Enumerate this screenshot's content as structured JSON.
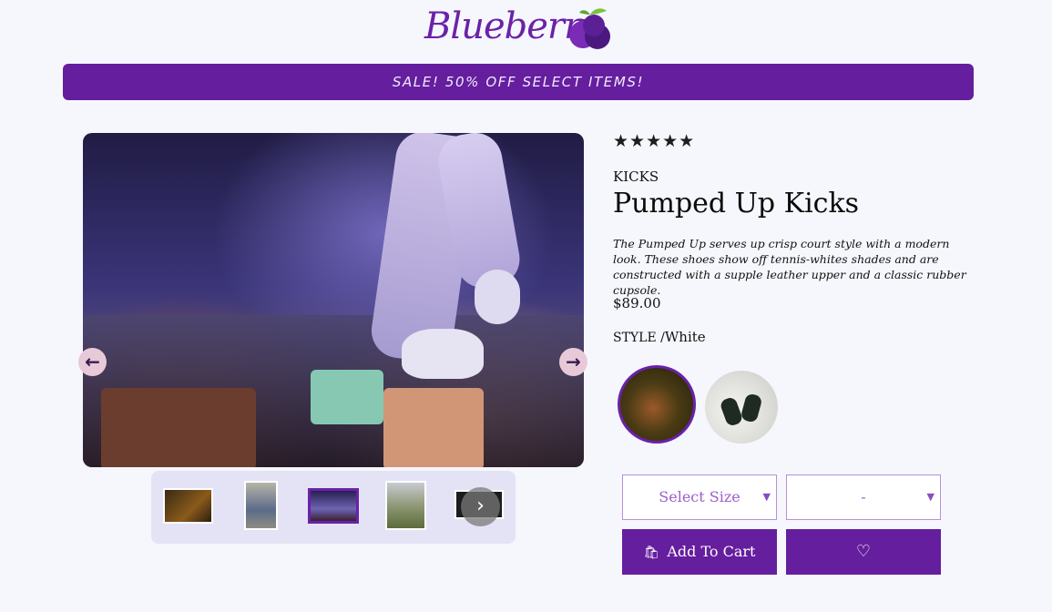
{
  "logo": {
    "text": "Blueberry"
  },
  "banner": {
    "text": "SALE! 50% OFF SELECT ITEMS!"
  },
  "gallery": {
    "prev_icon": "arrow-left-icon",
    "next_icon": "arrow-right-icon",
    "thumb_next_symbol": "›"
  },
  "product": {
    "rating_stars": "★★★★★",
    "rating": 5,
    "brand": "KICKS",
    "title": "Pumped Up Kicks",
    "description": "The Pumped Up serves up crisp court style with a modern look. These shoes show off tennis-whites shades and are constructed with a supple leather upper and a classic rubber cupsole.",
    "price": "$89.00",
    "style_label": "STYLE /",
    "style_value": "White"
  },
  "controls": {
    "size_select": "Select Size",
    "qty_select": "-",
    "add_to_cart": "Add To Cart",
    "favorite_icon": "heart-icon"
  },
  "colors": {
    "accent": "#651e9e",
    "background": "#f6f7fd"
  }
}
